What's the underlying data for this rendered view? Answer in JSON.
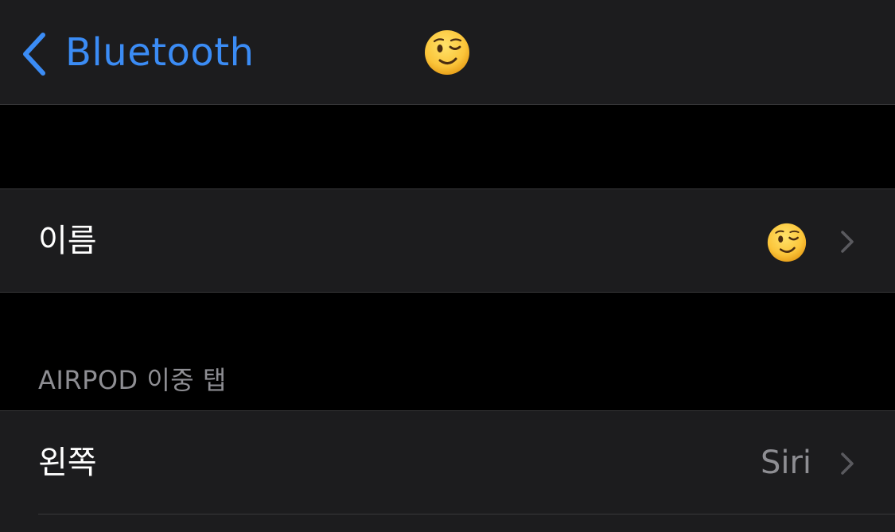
{
  "nav": {
    "back_label": "Bluetooth",
    "title_icon": "winking-face-emoji"
  },
  "name_row": {
    "label": "이름",
    "value_icon": "winking-face-emoji"
  },
  "double_tap_section": {
    "header": "AIRPOD 이중 탭"
  },
  "left_row": {
    "label": "왼쪽",
    "value": "Siri"
  },
  "colors": {
    "accent": "#3b8cf5",
    "cell_background": "#1c1c1e",
    "page_background": "#000000",
    "secondary_text": "#8e8e93",
    "separator": "#38383a"
  }
}
